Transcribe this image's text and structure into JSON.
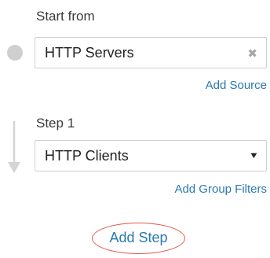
{
  "source": {
    "heading": "Start from",
    "value": "HTTP Servers",
    "clear_glyph": "✖",
    "add_source_label": "Add Source"
  },
  "step1": {
    "heading": "Step 1",
    "value": "HTTP Clients",
    "dropdown_glyph": "▼",
    "add_filters_label": "Add Group Filters"
  },
  "add_step_label": "Add Step",
  "colors": {
    "link": "#2a7ab0",
    "highlight_ring": "#e05a4f",
    "node_dot": "#cfcfcf",
    "arrow": "#d4d4d4"
  }
}
